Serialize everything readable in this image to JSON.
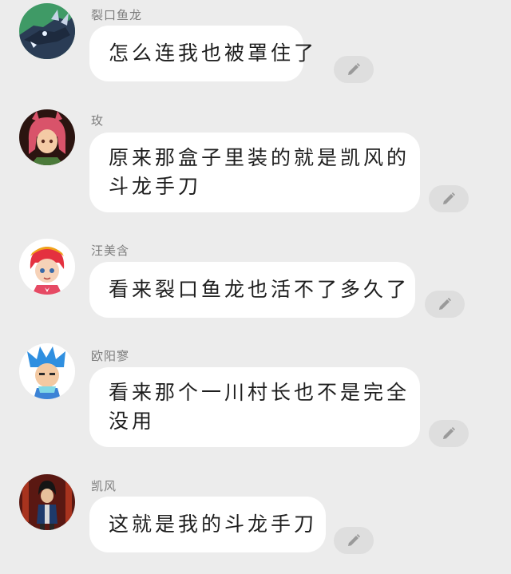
{
  "messages": [
    {
      "id": "m1",
      "sender": "裂口鱼龙",
      "lines": [
        "怎么连我也被罩住了"
      ],
      "avatar_icon": "dragon-avatar-icon"
    },
    {
      "id": "m2",
      "sender": "玫",
      "lines": [
        "原来那盒子里装的就是凯风的",
        "斗龙手刀"
      ],
      "avatar_icon": "mei-avatar-icon"
    },
    {
      "id": "m3",
      "sender": "汪美含",
      "lines": [
        "看来裂口鱼龙也活不了多久了"
      ],
      "avatar_icon": "wang-meihan-avatar-icon"
    },
    {
      "id": "m4",
      "sender": "欧阳寥",
      "lines": [
        "看来那个一川村长也不是完全",
        "没用"
      ],
      "avatar_icon": "ouyang-liao-avatar-icon"
    },
    {
      "id": "m5",
      "sender": "凯风",
      "lines": [
        "这就是我的斗龙手刀"
      ],
      "avatar_icon": "kaifeng-avatar-icon"
    }
  ],
  "icons": {
    "edit": "pencil-icon"
  },
  "colors": {
    "background": "#ececec",
    "bubble": "#ffffff",
    "name_text": "#7c7c7c",
    "edit_button": "#dedede"
  }
}
